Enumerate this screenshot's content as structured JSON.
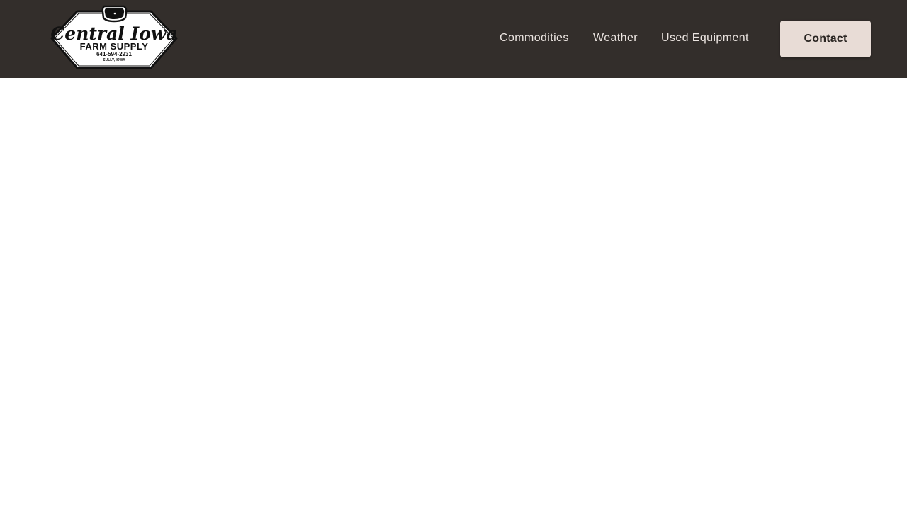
{
  "colors": {
    "header_background": "#332e2b",
    "nav_text": "#ece5e1",
    "contact_button_background": "#e8dcd6",
    "contact_button_text": "#2a2522",
    "page_background": "#ffffff"
  },
  "logo": {
    "line1": "Central Iowa",
    "line2": "FARM SUPPLY",
    "phone": "641-594-2931",
    "town": "SULLY, IOWA",
    "icon": "iowa-state-icon"
  },
  "nav": {
    "items": [
      {
        "label": "Commodities"
      },
      {
        "label": "Weather"
      },
      {
        "label": "Used Equipment"
      }
    ],
    "contact_label": "Contact"
  }
}
